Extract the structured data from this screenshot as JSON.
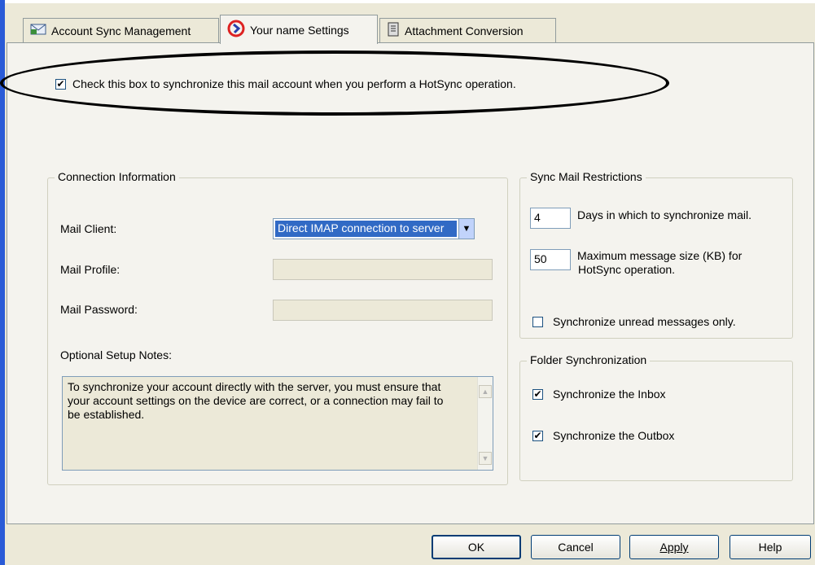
{
  "tabs": [
    {
      "label": "Account Sync Management",
      "icon": "mail-icon"
    },
    {
      "label": "Your name Settings",
      "icon": "hotsync-icon"
    },
    {
      "label": "Attachment Conversion",
      "icon": "document-icon"
    }
  ],
  "sync_checkbox": {
    "checked": true,
    "label": "Check this box to synchronize this mail account when you perform a HotSync operation."
  },
  "connection": {
    "title": "Connection Information",
    "mail_client_label": "Mail Client:",
    "mail_client_value": "Direct IMAP connection to server",
    "mail_profile_label": "Mail Profile:",
    "mail_password_label": "Mail Password:",
    "notes_label": "Optional Setup Notes:",
    "notes_text": "To synchronize your account directly with the server, you must ensure that your account settings on the device are correct, or a connection may fail to be established."
  },
  "restrictions": {
    "title": "Sync Mail Restrictions",
    "days_value": "4",
    "days_label": "Days in which to synchronize mail.",
    "size_value": "50",
    "size_label_1": "Maximum message size (KB)  for",
    "size_label_2": "HotSync operation.",
    "unread_checked": false,
    "unread_label": "Synchronize unread messages only."
  },
  "folders": {
    "title": "Folder Synchronization",
    "inbox_checked": true,
    "inbox_label": "Synchronize the Inbox",
    "outbox_checked": true,
    "outbox_label": "Synchronize the Outbox"
  },
  "buttons": {
    "ok": "OK",
    "cancel": "Cancel",
    "apply": "Apply",
    "help": "Help"
  },
  "colors": {
    "accent": "#2a5bd7",
    "selection": "#316ac5"
  }
}
